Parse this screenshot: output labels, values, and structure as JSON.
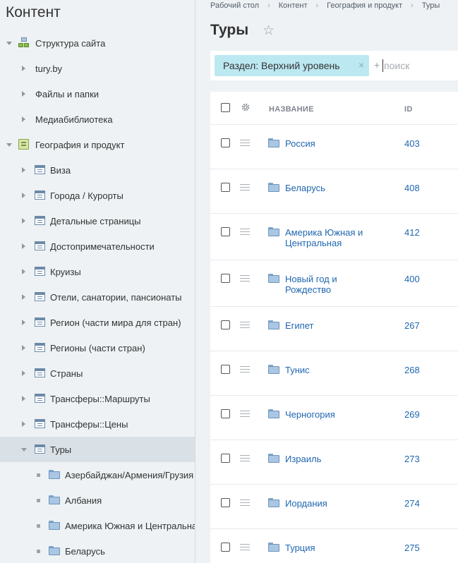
{
  "sidebar": {
    "title": "Контент",
    "items": [
      {
        "label": "Структура сайта",
        "icon": "site-structure-icon",
        "expander": "down"
      },
      {
        "label": "tury.by",
        "icon": "",
        "expander": "right"
      },
      {
        "label": "Файлы и папки",
        "icon": "",
        "expander": "right"
      },
      {
        "label": "Медиабиблиотека",
        "icon": "",
        "expander": "right"
      },
      {
        "label": "География и продукт",
        "icon": "iblock-type-icon",
        "expander": "down"
      },
      {
        "label": "Виза",
        "icon": "iblock-icon",
        "expander": "right"
      },
      {
        "label": "Города / Курорты",
        "icon": "iblock-icon",
        "expander": "right"
      },
      {
        "label": "Детальные страницы",
        "icon": "iblock-icon",
        "expander": "right"
      },
      {
        "label": "Достопримечательности",
        "icon": "iblock-icon",
        "expander": "right"
      },
      {
        "label": "Круизы",
        "icon": "iblock-icon",
        "expander": "right"
      },
      {
        "label": "Отели, санатории, пансионаты",
        "icon": "iblock-icon",
        "expander": "right"
      },
      {
        "label": "Регион (части мира для стран)",
        "icon": "iblock-icon",
        "expander": "right"
      },
      {
        "label": "Регионы (части стран)",
        "icon": "iblock-icon",
        "expander": "right"
      },
      {
        "label": "Страны",
        "icon": "iblock-icon",
        "expander": "right"
      },
      {
        "label": "Трансферы::Маршруты",
        "icon": "iblock-icon",
        "expander": "right"
      },
      {
        "label": "Трансферы::Цены",
        "icon": "iblock-icon",
        "expander": "right"
      },
      {
        "label": "Туры",
        "icon": "iblock-icon",
        "expander": "down",
        "active": true
      },
      {
        "label": "Азербайджан/Армения/Грузия",
        "icon": "folder-icon",
        "expander": "bullet"
      },
      {
        "label": "Албания",
        "icon": "folder-icon",
        "expander": "bullet"
      },
      {
        "label": "Америка Южная и Центральная",
        "icon": "folder-icon",
        "expander": "bullet"
      },
      {
        "label": "Беларусь",
        "icon": "folder-icon",
        "expander": "bullet"
      }
    ]
  },
  "breadcrumb": [
    "Рабочий стол",
    "Контент",
    "География и продукт",
    "Туры"
  ],
  "page": {
    "title": "Туры"
  },
  "filter": {
    "chip_label": "Раздел: Верхний уровень",
    "chip_close": "×",
    "search_plus": "+",
    "search_placeholder": "поиск"
  },
  "grid": {
    "columns": {
      "name": "НАЗВАНИЕ",
      "id": "ID"
    },
    "rows": [
      {
        "name": "Россия",
        "id": "403"
      },
      {
        "name": "Беларусь",
        "id": "408"
      },
      {
        "name": "Америка Южная и Центральная",
        "id": "412"
      },
      {
        "name": "Новый год и Рождество",
        "id": "400"
      },
      {
        "name": "Египет",
        "id": "267"
      },
      {
        "name": "Тунис",
        "id": "268"
      },
      {
        "name": "Черногория",
        "id": "269"
      },
      {
        "name": "Израиль",
        "id": "273"
      },
      {
        "name": "Иордания",
        "id": "274"
      },
      {
        "name": "Турция",
        "id": "275"
      }
    ]
  },
  "colors": {
    "link": "#2067b0",
    "chip_bg": "#bce8f1",
    "active_row": "#d9e1e6"
  }
}
